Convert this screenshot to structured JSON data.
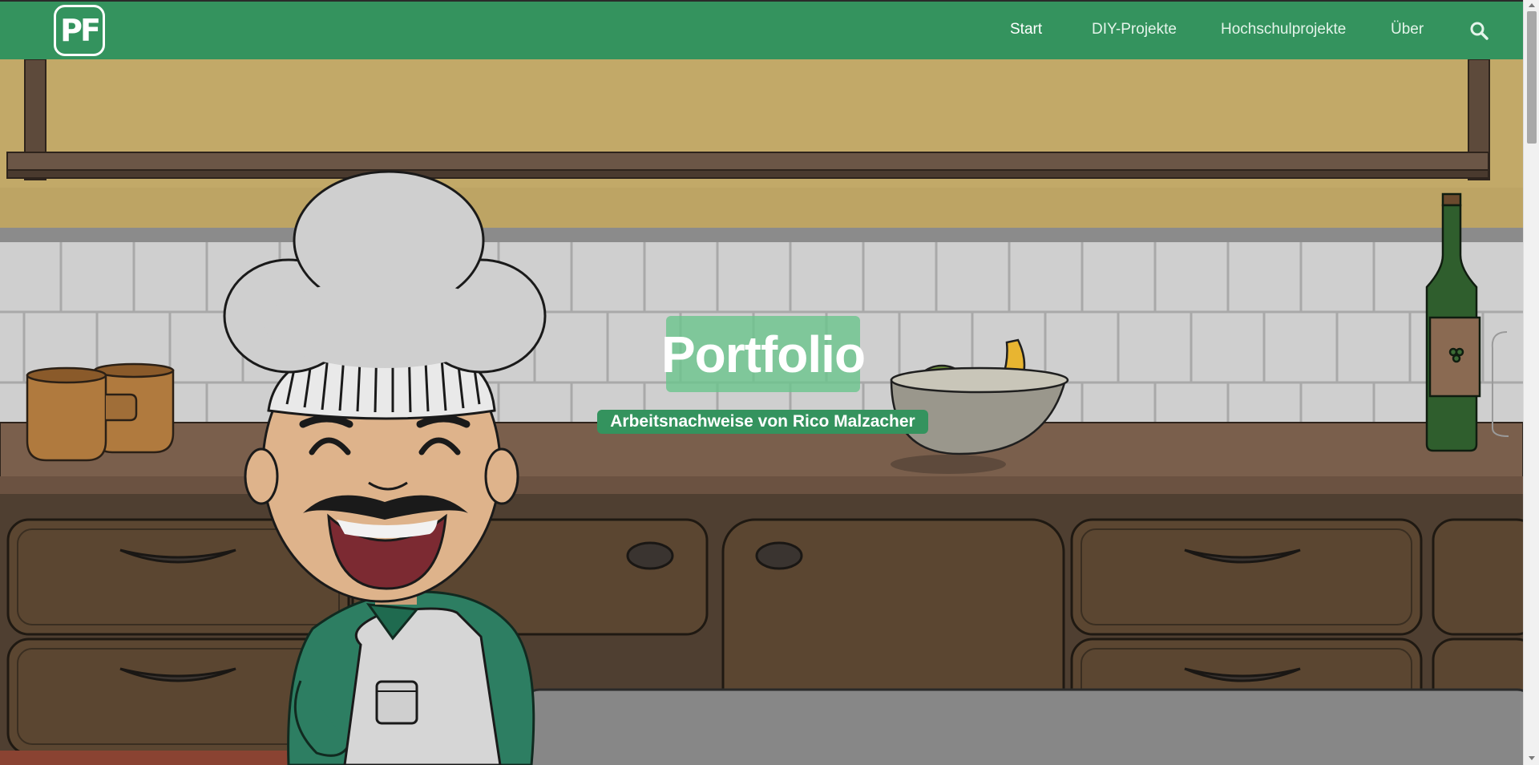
{
  "site": {
    "logo_text": "PF",
    "brand_color": "#34935e"
  },
  "nav": {
    "items": [
      {
        "label": "Start",
        "active": true
      },
      {
        "label": "DIY-Projekte",
        "active": false
      },
      {
        "label": "Hochschulprojekte",
        "active": false
      },
      {
        "label": "Über",
        "active": false
      }
    ],
    "search_icon": "search-icon"
  },
  "hero": {
    "title": "Portfolio",
    "subtitle": "Arbeitsnachweise von Rico Malzacher",
    "illustration": "cartoon chef in kitchen"
  }
}
